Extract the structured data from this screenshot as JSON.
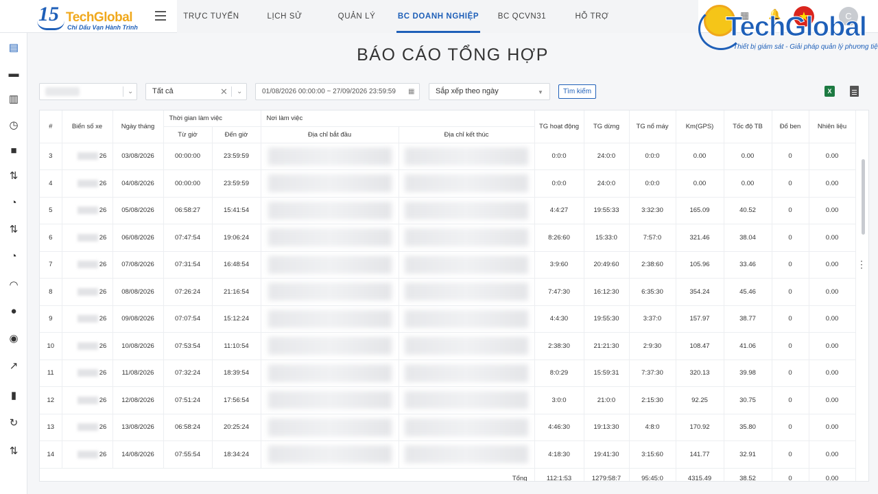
{
  "header": {
    "logo_number": "15",
    "logo_brand": "TechGlobal",
    "logo_slogan": "Chỉ Dấu Vạn Hành Trình",
    "menu": [
      {
        "label": "TRỰC TUYẾN",
        "active": false
      },
      {
        "label": "LỊCH SỬ",
        "active": false
      },
      {
        "label": "QUẢN LÝ",
        "active": false
      },
      {
        "label": "BC DOANH NGHIỆP",
        "active": true
      },
      {
        "label": "BC QCVN31",
        "active": false
      },
      {
        "label": "HỖ TRỢ",
        "active": false
      }
    ],
    "right_logo_text": "TechGlobal",
    "right_logo_tagline": "Thiết bị giám sát - Giải pháp quản lý phương tiện",
    "flag_symbol": "★",
    "avatar_letter": "C",
    "accent_color": "#1e5fb8"
  },
  "sidebar": {
    "icons": [
      "calendar-icon",
      "document-icon",
      "clipboard-icon",
      "history-icon",
      "stop-icon",
      "transfer-icon",
      "timer-icon",
      "transfer-icon",
      "timer-icon",
      "speedometer-icon",
      "location-pin-icon",
      "target-icon",
      "trend-icon",
      "bar-chart-icon",
      "refresh-icon",
      "transfer-icon"
    ],
    "active_index": 0
  },
  "page": {
    "title": "BÁO CÁO TỔNG HỢP"
  },
  "filters": {
    "status_value": "Tất cả",
    "date_range": "01/08/2026 00:00:00 ~ 27/09/2026 23:59:59",
    "sort_value": "Sắp xếp theo ngày",
    "search_label": "Tìm kiếm",
    "excel_label": "X"
  },
  "table": {
    "headers": {
      "index": "#",
      "plate": "Biển số xe",
      "date": "Ngày tháng",
      "work_time": "Thời gian làm việc",
      "from": "Từ giờ",
      "to": "Đến giờ",
      "workplace": "Nơi làm việc",
      "start_addr": "Địa chỉ bắt đầu",
      "end_addr": "Địa chỉ kết thúc",
      "run_time": "TG hoạt động",
      "stop_time": "TG dừng",
      "engine_time": "TG nổ máy",
      "km": "Km(GPS)",
      "avg_speed": "Tốc độ TB",
      "fuel_fill": "Đổ ben",
      "fuel": "Nhiên liệu"
    },
    "rows": [
      {
        "idx": "3",
        "plate": "26",
        "date": "03/08/2026",
        "from": "00:00:00",
        "to": "23:59:59",
        "run": "0:0:0",
        "stop": "24:0:0",
        "engine": "0:0:0",
        "km": "0.00",
        "speed": "0.00",
        "fill": "0",
        "fuel": "0.00"
      },
      {
        "idx": "4",
        "plate": "26",
        "date": "04/08/2026",
        "from": "00:00:00",
        "to": "23:59:59",
        "run": "0:0:0",
        "stop": "24:0:0",
        "engine": "0:0:0",
        "km": "0.00",
        "speed": "0.00",
        "fill": "0",
        "fuel": "0.00"
      },
      {
        "idx": "5",
        "plate": "26",
        "date": "05/08/2026",
        "from": "06:58:27",
        "to": "15:41:54",
        "run": "4:4:27",
        "stop": "19:55:33",
        "engine": "3:32:30",
        "km": "165.09",
        "speed": "40.52",
        "fill": "0",
        "fuel": "0.00"
      },
      {
        "idx": "6",
        "plate": "26",
        "date": "06/08/2026",
        "from": "07:47:54",
        "to": "19:06:24",
        "run": "8:26:60",
        "stop": "15:33:0",
        "engine": "7:57:0",
        "km": "321.46",
        "speed": "38.04",
        "fill": "0",
        "fuel": "0.00"
      },
      {
        "idx": "7",
        "plate": "26",
        "date": "07/08/2026",
        "from": "07:31:54",
        "to": "16:48:54",
        "run": "3:9:60",
        "stop": "20:49:60",
        "engine": "2:38:60",
        "km": "105.96",
        "speed": "33.46",
        "fill": "0",
        "fuel": "0.00"
      },
      {
        "idx": "8",
        "plate": "26",
        "date": "08/08/2026",
        "from": "07:26:24",
        "to": "21:16:54",
        "run": "7:47:30",
        "stop": "16:12:30",
        "engine": "6:35:30",
        "km": "354.24",
        "speed": "45.46",
        "fill": "0",
        "fuel": "0.00"
      },
      {
        "idx": "9",
        "plate": "26",
        "date": "09/08/2026",
        "from": "07:07:54",
        "to": "15:12:24",
        "run": "4:4:30",
        "stop": "19:55:30",
        "engine": "3:37:0",
        "km": "157.97",
        "speed": "38.77",
        "fill": "0",
        "fuel": "0.00"
      },
      {
        "idx": "10",
        "plate": "26",
        "date": "10/08/2026",
        "from": "07:53:54",
        "to": "11:10:54",
        "run": "2:38:30",
        "stop": "21:21:30",
        "engine": "2:9:30",
        "km": "108.47",
        "speed": "41.06",
        "fill": "0",
        "fuel": "0.00"
      },
      {
        "idx": "11",
        "plate": "26",
        "date": "11/08/2026",
        "from": "07:32:24",
        "to": "18:39:54",
        "run": "8:0:29",
        "stop": "15:59:31",
        "engine": "7:37:30",
        "km": "320.13",
        "speed": "39.98",
        "fill": "0",
        "fuel": "0.00"
      },
      {
        "idx": "12",
        "plate": "26",
        "date": "12/08/2026",
        "from": "07:51:24",
        "to": "17:56:54",
        "run": "3:0:0",
        "stop": "21:0:0",
        "engine": "2:15:30",
        "km": "92.25",
        "speed": "30.75",
        "fill": "0",
        "fuel": "0.00"
      },
      {
        "idx": "13",
        "plate": "26",
        "date": "13/08/2026",
        "from": "06:58:24",
        "to": "20:25:24",
        "run": "4:46:30",
        "stop": "19:13:30",
        "engine": "4:8:0",
        "km": "170.92",
        "speed": "35.80",
        "fill": "0",
        "fuel": "0.00"
      },
      {
        "idx": "14",
        "plate": "26",
        "date": "14/08/2026",
        "from": "07:55:54",
        "to": "18:34:24",
        "run": "4:18:30",
        "stop": "19:41:30",
        "engine": "3:15:60",
        "km": "141.77",
        "speed": "32.91",
        "fill": "0",
        "fuel": "0.00"
      }
    ],
    "total": {
      "label": "Tổng",
      "run": "112:1:53",
      "stop": "1279:58:7",
      "engine": "95:45:0",
      "km": "4315.49",
      "speed": "38.52",
      "fill": "0",
      "fuel": "0.00"
    }
  }
}
